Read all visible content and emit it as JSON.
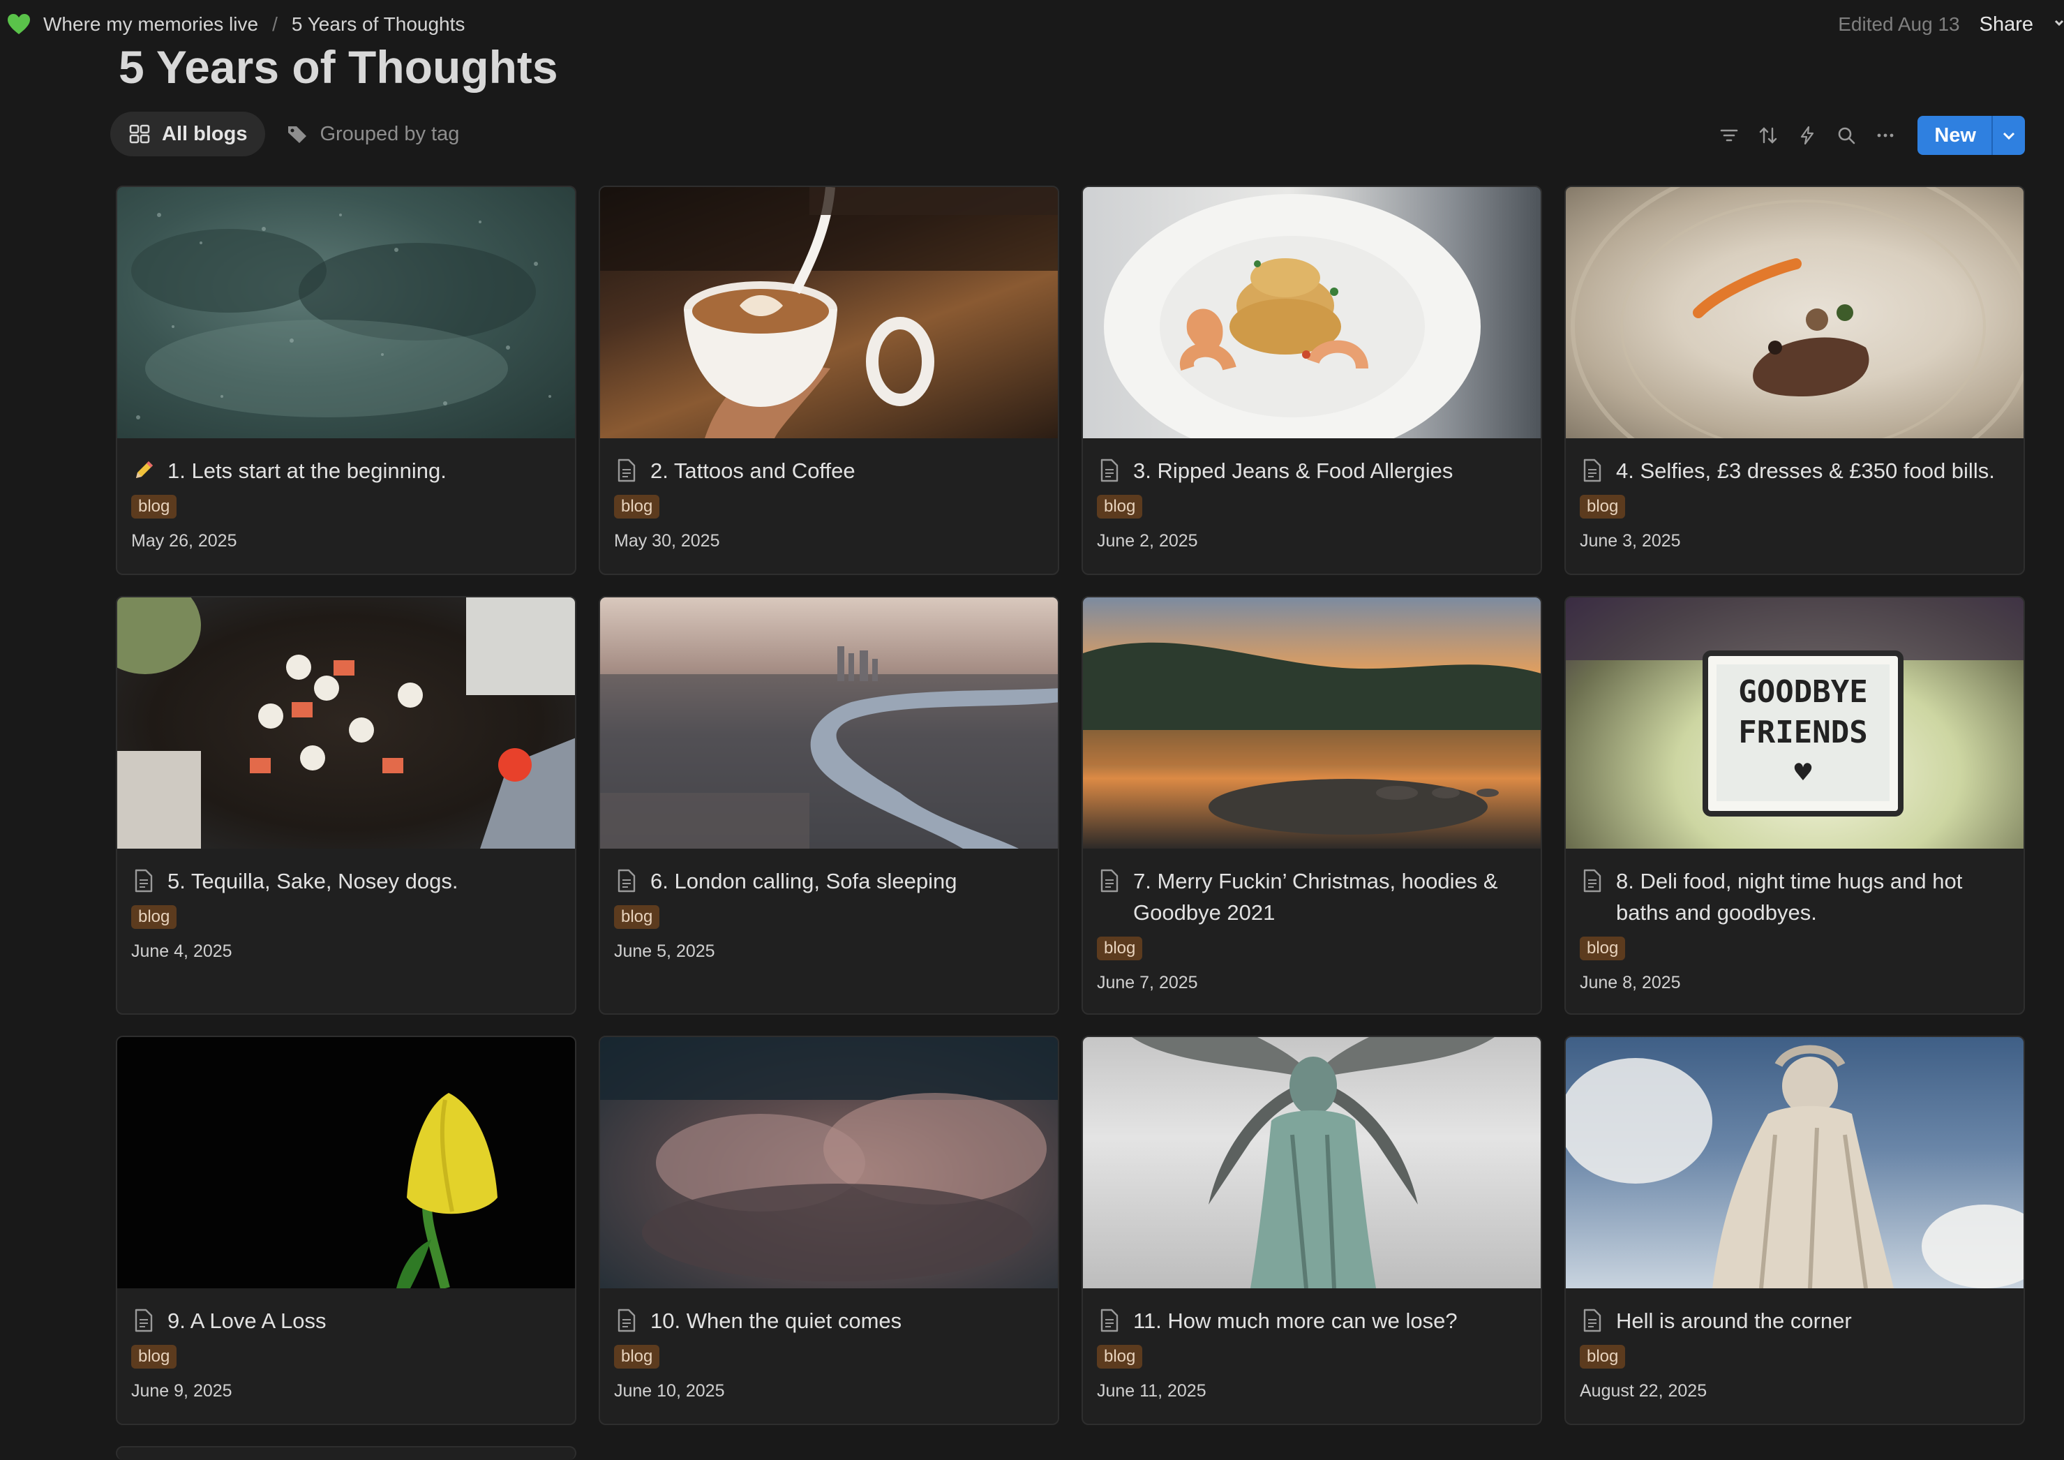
{
  "breadcrumb": {
    "parent": "Where my memories live",
    "separator": "/",
    "current": "5 Years of Thoughts"
  },
  "header": {
    "edited": "Edited Aug 13",
    "share": "Share"
  },
  "page": {
    "title": "5 Years of Thoughts"
  },
  "views": [
    {
      "label": "All blogs",
      "icon": "gallery-grid-icon",
      "active": true
    },
    {
      "label": "Grouped by tag",
      "icon": "tag-icon",
      "active": false
    }
  ],
  "toolbar": {
    "icons": [
      "filter-icon",
      "sort-icon",
      "automation-bolt-icon",
      "search-icon",
      "more-icon"
    ],
    "new_label": "New"
  },
  "cards": [
    {
      "title": "1. Lets start at the beginning.",
      "icon": "pencil-icon",
      "tag": "blog",
      "date": "May 26, 2025",
      "image": "rain-storm-clouds"
    },
    {
      "title": "2. Tattoos and Coffee",
      "icon": "page-icon",
      "tag": "blog",
      "date": "May 30, 2025",
      "image": "latte-art-coffee"
    },
    {
      "title": "3. Ripped Jeans & Food Allergies",
      "icon": "page-icon",
      "tag": "blog",
      "date": "June 2, 2025",
      "image": "shrimp-plate"
    },
    {
      "title": "4. Selfies, £3 dresses & £350 food bills.",
      "icon": "page-icon",
      "tag": "blog",
      "date": "June 3, 2025",
      "image": "fine-dining-plate"
    },
    {
      "title": "5. Tequilla,  Sake,  Nosey dogs.",
      "icon": "page-icon",
      "tag": "blog",
      "date": "June 4, 2025",
      "image": "sushi-board"
    },
    {
      "title": "6. London calling, Sofa sleeping",
      "icon": "page-icon",
      "tag": "blog",
      "date": "June 5, 2025",
      "image": "london-river-aerial"
    },
    {
      "title": "7. Merry Fuckin’ Christmas, hoodies & Goodbye 2021",
      "icon": "page-icon",
      "tag": "blog",
      "date": "June 7, 2025",
      "image": "lake-sunset"
    },
    {
      "title": "8. Deli food, night time hugs and hot baths and goodbyes.",
      "icon": "page-icon",
      "tag": "blog",
      "date": "June 8, 2025",
      "image": "goodbye-friends-lightbox"
    },
    {
      "title": "9. A Love A Loss",
      "icon": "page-icon",
      "tag": "blog",
      "date": "June 9, 2025",
      "image": "yellow-tulip"
    },
    {
      "title": "10. When the quiet comes",
      "icon": "page-icon",
      "tag": "blog",
      "date": "June 10, 2025",
      "image": "pink-clouds"
    },
    {
      "title": "11.  How much more can we lose?",
      "icon": "page-icon",
      "tag": "blog",
      "date": "June 11, 2025",
      "image": "angel-statue"
    },
    {
      "title": "Hell is around the corner",
      "icon": "page-icon",
      "tag": "blog",
      "date": "August 22, 2025",
      "image": "dante-statue"
    }
  ],
  "lightbox_text": {
    "line1": "GOODBYE",
    "line2": "FRIENDS",
    "symbol": "♥"
  },
  "colors": {
    "accent": "#2f80e0",
    "tag_bg": "#5c3b1e",
    "tag_text": "#e8d3bd",
    "background": "#191919",
    "card_bg": "#202020"
  }
}
